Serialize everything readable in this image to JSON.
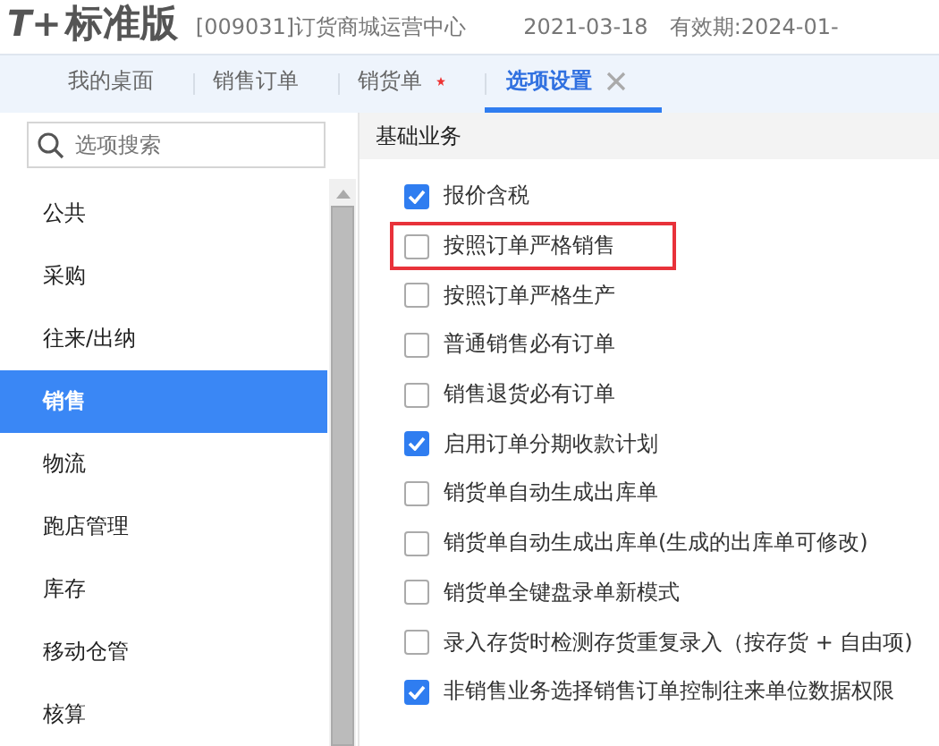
{
  "header": {
    "logo": "T+",
    "edition": "标准版",
    "account": "[009031]订货商城运营中心",
    "date": "2021-03-18",
    "validity": "有效期:2024-01-"
  },
  "tabs": [
    {
      "label": "我的桌面",
      "selected": false,
      "modified": false,
      "closable": false
    },
    {
      "label": "销售订单",
      "selected": false,
      "modified": false,
      "closable": false
    },
    {
      "label": "销货单",
      "selected": false,
      "modified": true,
      "closable": false
    },
    {
      "label": "选项设置",
      "selected": true,
      "modified": false,
      "closable": true
    }
  ],
  "search": {
    "placeholder": "选项搜索"
  },
  "sidebar": {
    "items": [
      {
        "label": "公共",
        "selected": false
      },
      {
        "label": "采购",
        "selected": false
      },
      {
        "label": "往来/出纳",
        "selected": false
      },
      {
        "label": "销售",
        "selected": true
      },
      {
        "label": "物流",
        "selected": false
      },
      {
        "label": "跑店管理",
        "selected": false
      },
      {
        "label": "库存",
        "selected": false
      },
      {
        "label": "移动仓管",
        "selected": false
      },
      {
        "label": "核算",
        "selected": false
      }
    ]
  },
  "section": {
    "title": "基础业务"
  },
  "options": [
    {
      "label": "报价含税",
      "checked": true,
      "highlighted": false
    },
    {
      "label": "按照订单严格销售",
      "checked": false,
      "highlighted": true
    },
    {
      "label": "按照订单严格生产",
      "checked": false,
      "highlighted": false
    },
    {
      "label": "普通销售必有订单",
      "checked": false,
      "highlighted": false
    },
    {
      "label": "销售退货必有订单",
      "checked": false,
      "highlighted": false
    },
    {
      "label": "启用订单分期收款计划",
      "checked": true,
      "highlighted": false
    },
    {
      "label": "销货单自动生成出库单",
      "checked": false,
      "highlighted": false
    },
    {
      "label": "销货单自动生成出库单(生成的出库单可修改)",
      "checked": false,
      "highlighted": false
    },
    {
      "label": "销货单全键盘录单新模式",
      "checked": false,
      "highlighted": false
    },
    {
      "label": "录入存货时检测存货重复录入（按存货 + 自由项)",
      "checked": false,
      "highlighted": false
    },
    {
      "label": "非销售业务选择销售订单控制往来单位数据权限",
      "checked": true,
      "highlighted": false
    }
  ]
}
